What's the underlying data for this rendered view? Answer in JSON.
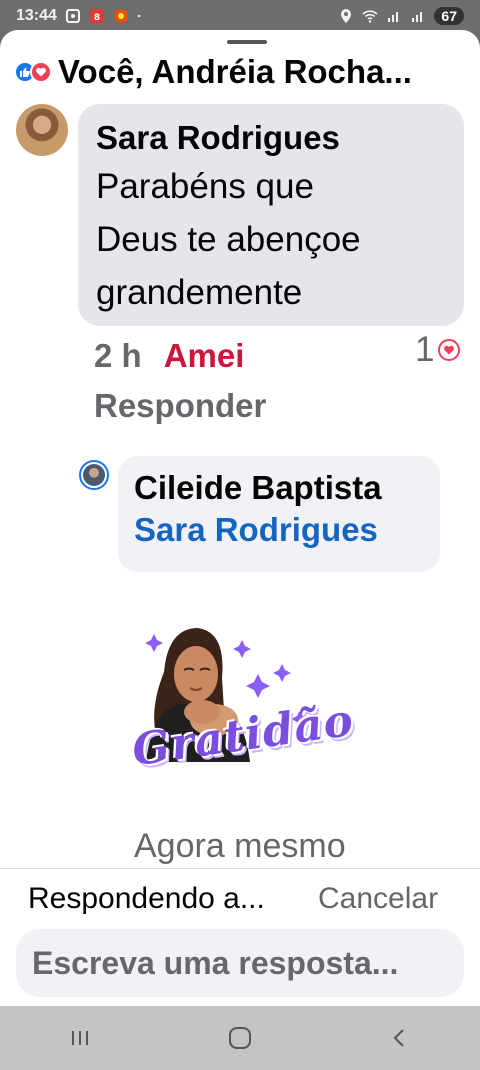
{
  "status_bar": {
    "time": "13:44",
    "battery": "67",
    "icons": [
      "screenshot-icon",
      "app-icon",
      "app-icon-2",
      "dot-icon",
      "location-icon",
      "wifi-icon",
      "signal-icon",
      "signal-icon-2",
      "battery-icon"
    ]
  },
  "header": {
    "title": "Você, Andréia Rocha...",
    "reaction_icons": [
      "like-icon",
      "love-icon"
    ]
  },
  "comments": [
    {
      "author": "Sara Rodrigues",
      "text_lines": [
        "Parabéns que",
        "Deus te abençoe",
        "grandemente"
      ],
      "time": "2 h",
      "reaction_label": "Amei",
      "reply_label": "Responder",
      "reaction_count": "1"
    },
    {
      "author": "Cileide Baptista",
      "tag": "Sara Rodrigues",
      "sticker_text": "Gratidão",
      "time": "Agora mesmo"
    }
  ],
  "reply_bar": {
    "replying_label": "Respondendo a...",
    "cancel_label": "Cancelar",
    "input_placeholder": "Escreva uma resposta..."
  },
  "colors": {
    "accent": "#1877f2",
    "love": "#d0143c",
    "tag_blue": "#1565c0",
    "sticker_purple": "#7b4ee0"
  },
  "nav": [
    "recents-icon",
    "home-icon",
    "back-icon"
  ]
}
